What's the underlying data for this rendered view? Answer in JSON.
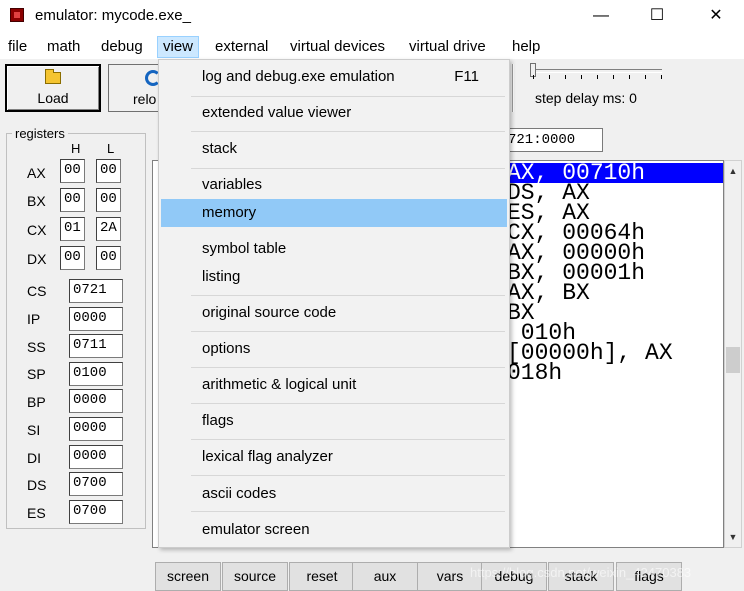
{
  "window": {
    "title": "emulator: mycode.exe_",
    "minimize_glyph": "—",
    "maximize_glyph": "☐",
    "close_glyph": "✕"
  },
  "menubar": {
    "items": [
      {
        "label": "file"
      },
      {
        "label": "math"
      },
      {
        "label": "debug"
      },
      {
        "label": "view"
      },
      {
        "label": "external"
      },
      {
        "label": "virtual devices"
      },
      {
        "label": "virtual drive"
      },
      {
        "label": "help"
      }
    ],
    "open_menu": "view"
  },
  "toolbar": {
    "load_label": "Load",
    "reload_label": "relo",
    "step_delay_label": "step delay ms: 0",
    "step_delay_ms": 0
  },
  "registers": {
    "group_label": "registers",
    "col_h": "H",
    "col_l": "L",
    "split": [
      {
        "name": "AX",
        "h": "00",
        "l": "00"
      },
      {
        "name": "BX",
        "h": "00",
        "l": "00"
      },
      {
        "name": "CX",
        "h": "01",
        "l": "2A"
      },
      {
        "name": "DX",
        "h": "00",
        "l": "00"
      }
    ],
    "wide": [
      {
        "name": "CS",
        "value": "0721"
      },
      {
        "name": "IP",
        "value": "0000"
      },
      {
        "name": "SS",
        "value": "0711"
      },
      {
        "name": "SP",
        "value": "0100"
      },
      {
        "name": "BP",
        "value": "0000"
      },
      {
        "name": "SI",
        "value": "0000"
      },
      {
        "name": "DI",
        "value": "0000"
      },
      {
        "name": "DS",
        "value": "0700"
      },
      {
        "name": "ES",
        "value": "0700"
      }
    ]
  },
  "address_field": "721:0000",
  "code": {
    "lines": [
      {
        "text": "AX, 00710h",
        "selected": true
      },
      {
        "text": "DS, AX",
        "selected": false
      },
      {
        "text": "ES, AX",
        "selected": false
      },
      {
        "text": "CX, 00064h",
        "selected": false
      },
      {
        "text": "AX, 00000h",
        "selected": false
      },
      {
        "text": "BX, 00001h",
        "selected": false
      },
      {
        "text": "AX, BX",
        "selected": false
      },
      {
        "text": "BX",
        "selected": false
      },
      {
        "text": " 010h",
        "selected": false
      },
      {
        "text": "[00000h], AX",
        "selected": false
      },
      {
        "text": "018h",
        "selected": false
      }
    ],
    "scroll_up": "▲",
    "scroll_down": "▼"
  },
  "view_menu": {
    "items": [
      {
        "label": "log and debug.exe emulation",
        "shortcut": "F11"
      },
      {
        "label": "extended value viewer"
      },
      {
        "label": "stack"
      },
      {
        "label": "variables"
      },
      {
        "label": "memory",
        "highlighted": true
      },
      {
        "label": "symbol table"
      },
      {
        "label": "listing"
      },
      {
        "label": "original source code"
      },
      {
        "label": "options"
      },
      {
        "label": "arithmetic & logical unit"
      },
      {
        "label": "flags"
      },
      {
        "label": "lexical flag analyzer"
      },
      {
        "label": "ascii codes"
      },
      {
        "label": "emulator screen"
      }
    ]
  },
  "bottom_buttons": [
    {
      "label": "screen"
    },
    {
      "label": "source"
    },
    {
      "label": "reset"
    },
    {
      "label": "aux"
    },
    {
      "label": "vars"
    },
    {
      "label": "debug"
    },
    {
      "label": "stack"
    },
    {
      "label": "flags"
    }
  ],
  "watermark": "https://blog.csdn.net/weixin_42470383"
}
